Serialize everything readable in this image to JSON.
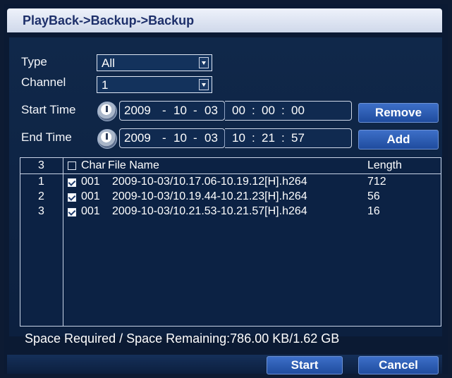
{
  "window": {
    "title": "PlayBack->Backup->Backup"
  },
  "form": {
    "type_label": "Type",
    "type_value": "All",
    "channel_label": "Channel",
    "channel_value": "1",
    "start_label": "Start Time",
    "start_date": {
      "year": "2009",
      "month": "10",
      "day": "03"
    },
    "start_time": {
      "hh": "00",
      "mm": "00",
      "ss": "00"
    },
    "end_label": "End Time",
    "end_date": {
      "year": "2009",
      "month": "10",
      "day": "03"
    },
    "end_time": {
      "hh": "10",
      "mm": "21",
      "ss": "57"
    },
    "date_sep": "-",
    "time_sep": ":"
  },
  "buttons": {
    "remove": "Remove",
    "add": "Add",
    "start": "Start",
    "cancel": "Cancel"
  },
  "table": {
    "header_count": "3",
    "header_char": "Char",
    "header_file": "File Name",
    "header_length": "Length",
    "rows": [
      {
        "idx": "1",
        "checked": true,
        "char": "001",
        "file": "2009-10-03/10.17.06-10.19.12[H].h264",
        "length": "712"
      },
      {
        "idx": "2",
        "checked": true,
        "char": "001",
        "file": "2009-10-03/10.19.44-10.21.23[H].h264",
        "length": "56"
      },
      {
        "idx": "3",
        "checked": true,
        "char": "001",
        "file": "2009-10-03/10.21.53-10.21.57[H].h264",
        "length": "16"
      }
    ]
  },
  "status": {
    "text": "Space Required / Space Remaining:786.00 KB/1.62 GB"
  },
  "icons": {
    "clock": "clock-icon",
    "dropdown": "chevron-down-icon",
    "checkbox": "checkbox-icon"
  },
  "colors": {
    "background": "#0b1a33",
    "title_bar": "#dfe5f2",
    "button": "#2a5bb4",
    "text": "#ffffff"
  }
}
